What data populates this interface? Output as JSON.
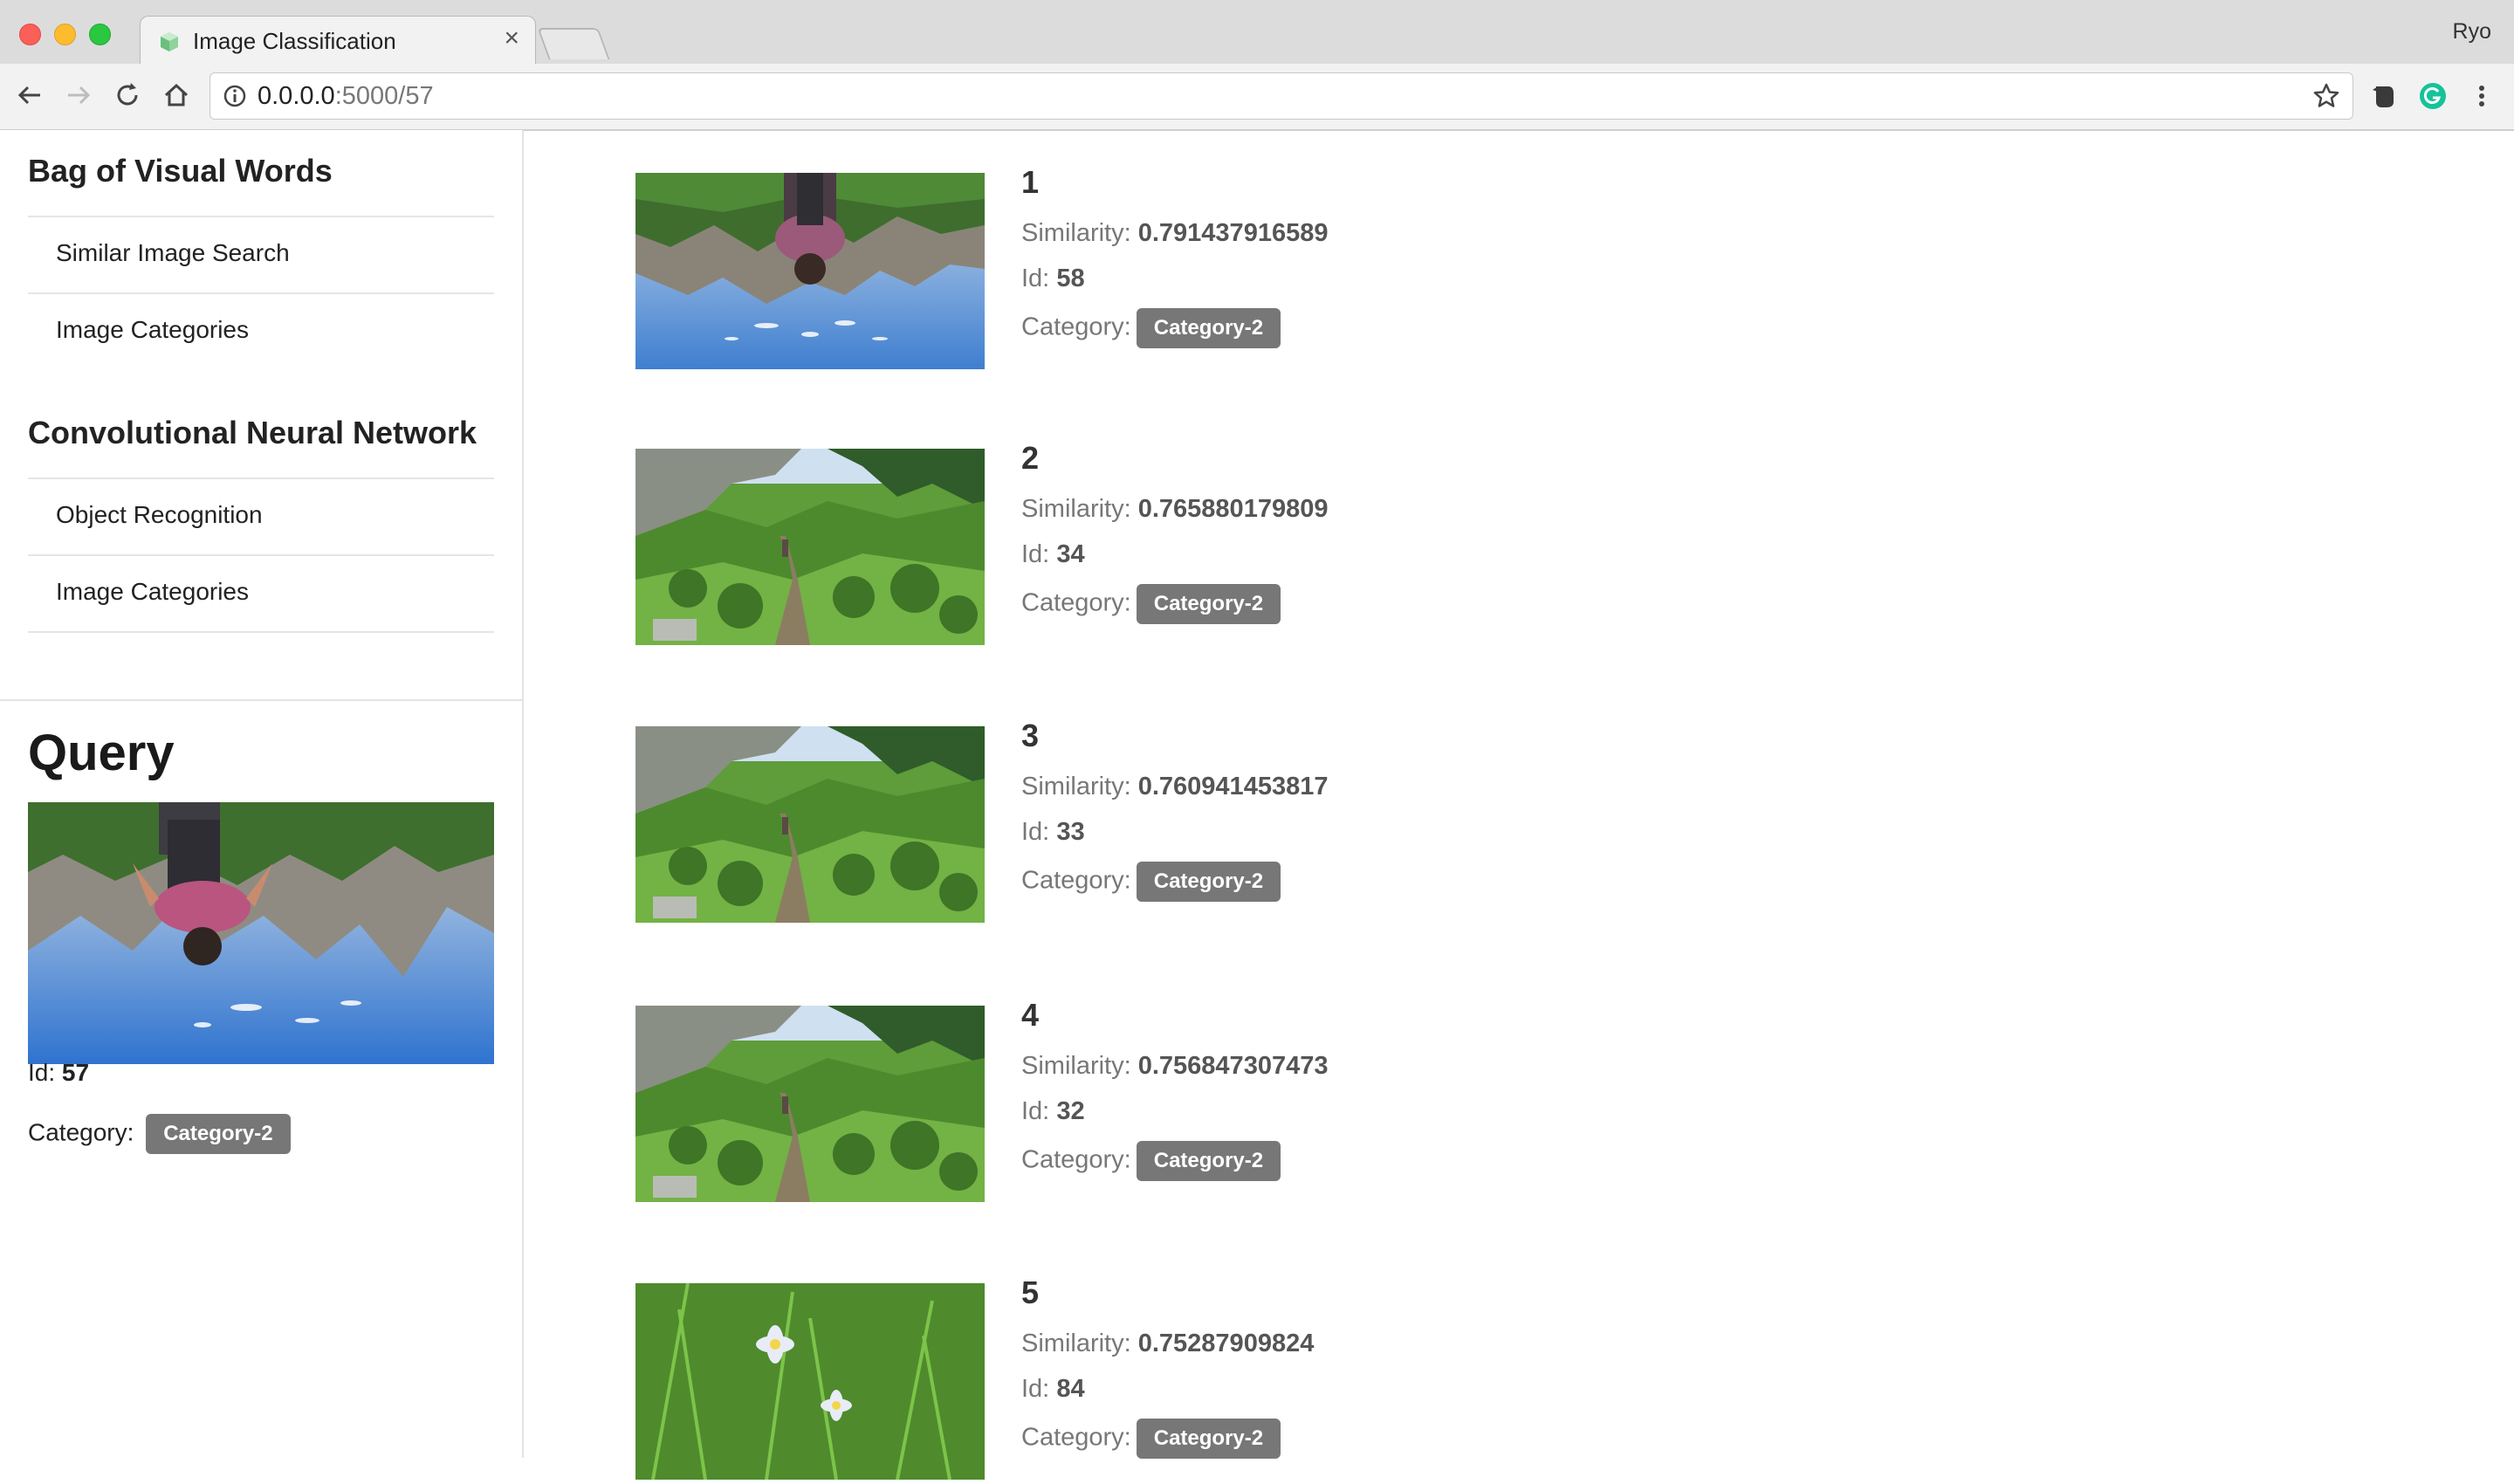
{
  "browser": {
    "tab_title": "Image Classification",
    "tab_close": "×",
    "profile_name": "Ryo",
    "url_host": "0.0.0.0",
    "url_rest": ":5000/57"
  },
  "sidebar": {
    "bovw_heading": "Bag of Visual Words",
    "bovw_items": [
      {
        "label": "Similar Image Search"
      },
      {
        "label": "Image Categories"
      }
    ],
    "cnn_heading": "Convolutional Neural Network",
    "cnn_items": [
      {
        "label": "Object Recognition"
      },
      {
        "label": "Image Categories"
      }
    ]
  },
  "query": {
    "title": "Query",
    "id_label": "Id:",
    "id_value": "57",
    "category_label": "Category:",
    "category_value": "Category-2"
  },
  "labels": {
    "similarity": "Similarity:",
    "id": "Id:",
    "category": "Category:"
  },
  "results": [
    {
      "rank": "1",
      "similarity": "0.791437916589",
      "id": "58",
      "category": "Category-2",
      "image": "upside-down-hiker-sky"
    },
    {
      "rank": "2",
      "similarity": "0.765880179809",
      "id": "34",
      "category": "Category-2",
      "image": "green-valley-trail"
    },
    {
      "rank": "3",
      "similarity": "0.760941453817",
      "id": "33",
      "category": "Category-2",
      "image": "green-valley-trail"
    },
    {
      "rank": "4",
      "similarity": "0.756847307473",
      "id": "32",
      "category": "Category-2",
      "image": "green-valley-trail"
    },
    {
      "rank": "5",
      "similarity": "0.75287909824",
      "id": "84",
      "category": "Category-2",
      "image": "wildflowers"
    }
  ],
  "colors": {
    "badge": "#777777",
    "link_text": "#222222",
    "muted_text": "#777777"
  }
}
